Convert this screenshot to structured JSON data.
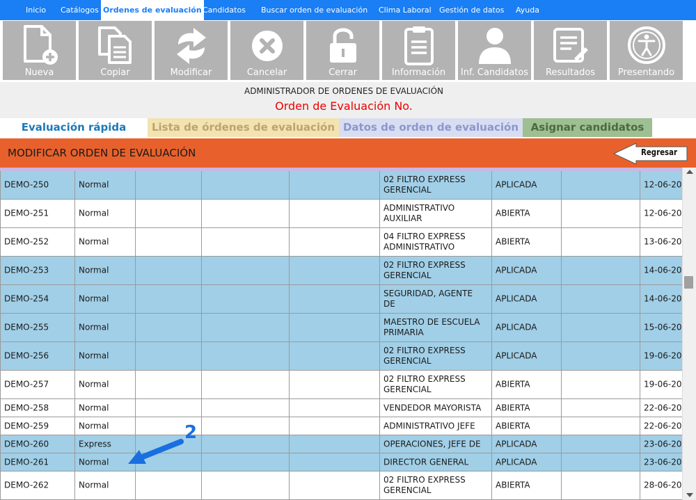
{
  "menu": {
    "items": [
      {
        "label": "Inicio",
        "active": false
      },
      {
        "label": "Catálogos",
        "active": false
      },
      {
        "label": "Ordenes de evaluación",
        "active": true
      },
      {
        "label": "Candidatos",
        "active": false
      },
      {
        "label": "Buscar orden de evaluación",
        "active": false
      },
      {
        "label": "Clima Laboral",
        "active": false
      },
      {
        "label": "Gestión de datos",
        "active": false
      },
      {
        "label": "Ayuda",
        "active": false
      }
    ]
  },
  "toolbar": {
    "buttons": [
      {
        "label": "Nueva",
        "icon": "new-file-icon"
      },
      {
        "label": "Copiar",
        "icon": "copy-icon"
      },
      {
        "label": "Modificar",
        "icon": "refresh-arrows-icon"
      },
      {
        "label": "Cancelar",
        "icon": "cancel-icon"
      },
      {
        "label": "Cerrar",
        "icon": "lock-icon"
      },
      {
        "label": "Información",
        "icon": "clipboard-icon"
      },
      {
        "label": "Inf. Candidatos",
        "icon": "person-icon"
      },
      {
        "label": "Resultados",
        "icon": "results-icon"
      },
      {
        "label": "Presentando",
        "icon": "accessibility-icon"
      }
    ]
  },
  "header": {
    "admin_title": "ADMINISTRADOR DE ORDENES DE EVALUACIÓN",
    "order_title": "Orden de Evaluación No."
  },
  "tabs": [
    {
      "label": "Evaluación rápida"
    },
    {
      "label": "Lista de órdenes de evaluación"
    },
    {
      "label": "Datos de orden de evaluación"
    },
    {
      "label": "Asignar candidatos"
    }
  ],
  "section": {
    "title": "MODIFICAR ORDEN DE EVALUACIÓN",
    "back_label": "Regresar"
  },
  "colors": {
    "menu_bar": "#1a7ef5",
    "orange_bar": "#e8612c",
    "row_aplicada": "#a1cfe7",
    "row_abierta": "#ffffff"
  },
  "table": {
    "rows": [
      {
        "id": "DEMO-250",
        "type": "Normal",
        "position": "02 FILTRO EXPRESS\nGERENCIAL",
        "status": "APLICADA",
        "date": "12-06-20"
      },
      {
        "id": "DEMO-251",
        "type": "Normal",
        "position": "ADMINISTRATIVO\nAUXILIAR",
        "status": "ABIERTA",
        "date": "12-06-20"
      },
      {
        "id": "DEMO-252",
        "type": "Normal",
        "position": "04 FILTRO EXPRESS\nADMINISTRATIVO",
        "status": "ABIERTA",
        "date": "13-06-20"
      },
      {
        "id": "DEMO-253",
        "type": "Normal",
        "position": "02 FILTRO EXPRESS\nGERENCIAL",
        "status": "APLICADA",
        "date": "14-06-20"
      },
      {
        "id": "DEMO-254",
        "type": "Normal",
        "position": "SEGURIDAD, AGENTE\nDE",
        "status": "APLICADA",
        "date": "14-06-20"
      },
      {
        "id": "DEMO-255",
        "type": "Normal",
        "position": "MAESTRO DE ESCUELA\nPRIMARIA",
        "status": "APLICADA",
        "date": "15-06-20"
      },
      {
        "id": "DEMO-256",
        "type": "Normal",
        "position": "02 FILTRO EXPRESS\nGERENCIAL",
        "status": "APLICADA",
        "date": "19-06-20"
      },
      {
        "id": "DEMO-257",
        "type": "Normal",
        "position": "02 FILTRO EXPRESS\nGERENCIAL",
        "status": "ABIERTA",
        "date": "19-06-20"
      },
      {
        "id": "DEMO-258",
        "type": "Normal",
        "position": "VENDEDOR MAYORISTA",
        "status": "ABIERTA",
        "date": "22-06-20"
      },
      {
        "id": "DEMO-259",
        "type": "Normal",
        "position": "ADMINISTRATIVO JEFE",
        "status": "ABIERTA",
        "date": "22-06-20"
      },
      {
        "id": "DEMO-260",
        "type": "Express",
        "position": "OPERACIONES, JEFE DE",
        "status": "APLICADA",
        "date": "23-06-20"
      },
      {
        "id": "DEMO-261",
        "type": "Normal",
        "position": "DIRECTOR GENERAL",
        "status": "APLICADA",
        "date": "23-06-20"
      },
      {
        "id": "DEMO-262",
        "type": "Normal",
        "position": "02 FILTRO EXPRESS\nGERENCIAL",
        "status": "ABIERTA",
        "date": "28-06-20"
      }
    ]
  },
  "annotation": {
    "number": "2"
  }
}
